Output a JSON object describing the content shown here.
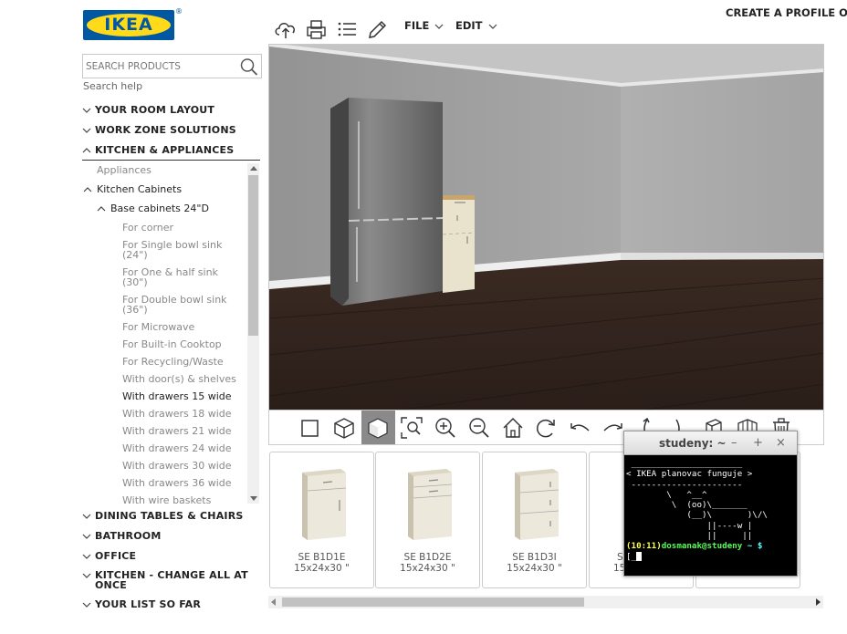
{
  "brand": {
    "logo_text": "IKEA",
    "registered": "®",
    "blue": "#0058a3",
    "yellow": "#ffda1a"
  },
  "header": {
    "file_label": "FILE",
    "edit_label": "EDIT",
    "profile_link": "CREATE A PROFILE OR LOG IN"
  },
  "search": {
    "placeholder": "SEARCH PRODUCTS",
    "help": "Search help"
  },
  "sidebar": {
    "sections": [
      {
        "label": "YOUR ROOM LAYOUT",
        "expanded": false
      },
      {
        "label": "WORK ZONE SOLUTIONS",
        "expanded": false
      },
      {
        "label": "KITCHEN & APPLIANCES",
        "expanded": true
      },
      {
        "label": "DINING TABLES & CHAIRS",
        "expanded": false
      },
      {
        "label": "BATHROOM",
        "expanded": false
      },
      {
        "label": "OFFICE",
        "expanded": false
      },
      {
        "label": "KITCHEN - CHANGE ALL AT",
        "label2": "ONCE",
        "expanded": false
      },
      {
        "label": "YOUR LIST SO FAR",
        "expanded": false
      }
    ],
    "kitchen_items": {
      "appliances": "Appliances",
      "kitchen_cabinets": "Kitchen Cabinets",
      "base_cabinets": "Base cabinets 24\"D",
      "children": [
        {
          "line1": "For corner"
        },
        {
          "line1": "For Single bowl sink",
          "line2": "(24\")"
        },
        {
          "line1": "For One & half sink",
          "line2": "(30\")"
        },
        {
          "line1": "For Double bowl sink",
          "line2": "(36\")"
        },
        {
          "line1": "For Microwave"
        },
        {
          "line1": "For Built-in Cooktop"
        },
        {
          "line1": "For Recycling/Waste"
        },
        {
          "line1": "With door(s) & shelves"
        },
        {
          "line1": "With drawers 15 wide",
          "selected": true
        },
        {
          "line1": "With drawers 18 wide"
        },
        {
          "line1": "With drawers 21 wide"
        },
        {
          "line1": "With drawers 24 wide"
        },
        {
          "line1": "With drawers 30 wide"
        },
        {
          "line1": "With drawers 36 wide"
        },
        {
          "line1": "With wire baskets"
        }
      ]
    }
  },
  "toolbar_icons": [
    "upload-icon",
    "print-icon",
    "list-icon",
    "pencil-icon"
  ],
  "view_toolbar_icons": [
    "2d-view-icon",
    "3d-view-icon",
    "3d-solid-view-icon",
    "zoom-fit-icon",
    "zoom-in-icon",
    "zoom-out-icon",
    "home-icon",
    "rotate-icon",
    "undo-icon",
    "redo-icon",
    "rotate-left-icon",
    "rotate-right-icon",
    "cabinet-icon",
    "wall-icon",
    "trash-icon"
  ],
  "products": [
    {
      "code": "SE B1D1E",
      "dims": "15x24x30 \""
    },
    {
      "code": "SE B1D2E",
      "dims": "15x24x30 \""
    },
    {
      "code": "SE B1D3I",
      "dims": "15x24x30 \""
    },
    {
      "code": "S",
      "dims": "15"
    }
  ],
  "terminal": {
    "title": "studeny: ~",
    "minimize": "–",
    "maximize": "+",
    "close": "×",
    "lines": [
      " ______________________",
      "< IKEA planovac funguje >",
      " ----------------------",
      "        \\   ^__^",
      "         \\  (oo)\\_______",
      "            (__)\\       )\\/\\",
      "                ||----w |",
      "                ||     ||"
    ],
    "prompt_time": "(10:11)",
    "prompt_user": "dosmanak@studeny",
    "prompt_path": " ~ $",
    "prompt2": "[_"
  }
}
